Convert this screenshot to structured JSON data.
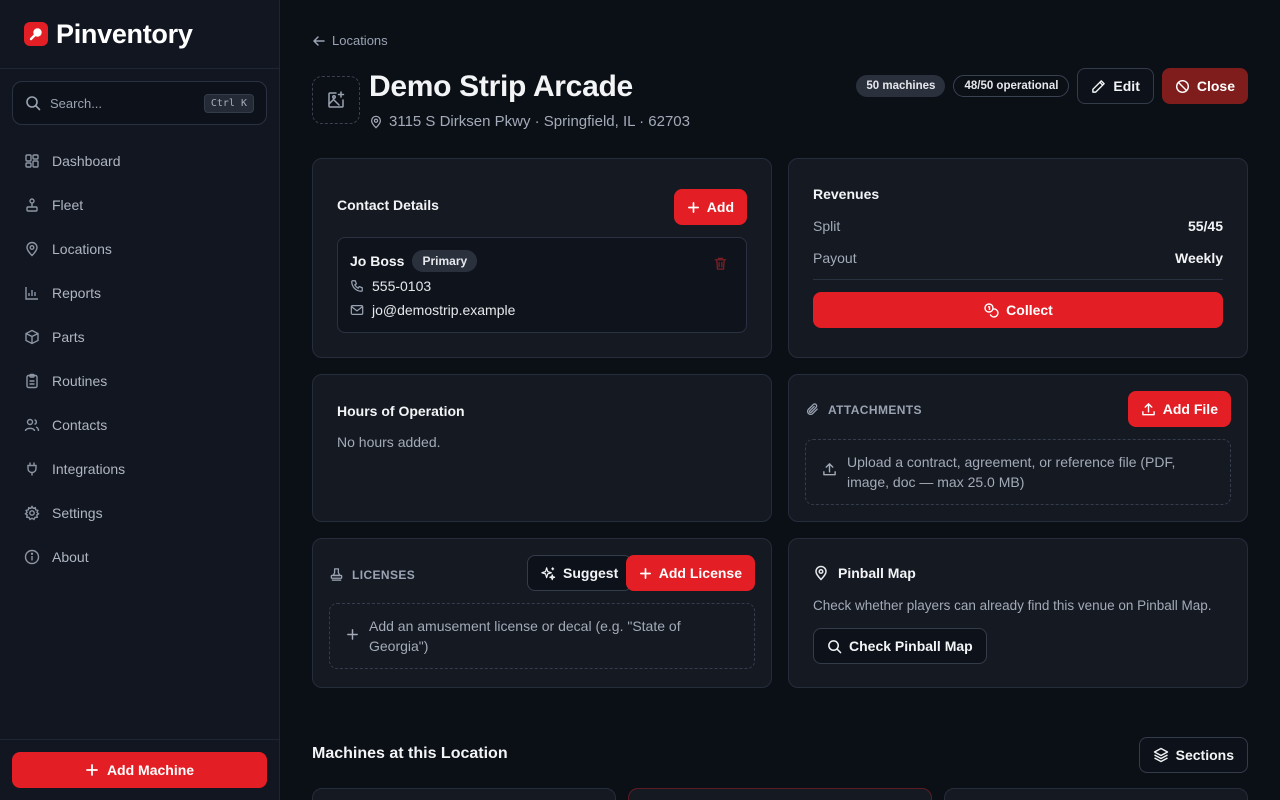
{
  "app": {
    "brand": "Pinventory",
    "search_placeholder": "Search...",
    "search_shortcut": "Ctrl K"
  },
  "sidebar": {
    "items": [
      {
        "label": "Dashboard",
        "icon": "dashboard-icon"
      },
      {
        "label": "Fleet",
        "icon": "fleet-icon"
      },
      {
        "label": "Locations",
        "icon": "map-pin-icon"
      },
      {
        "label": "Reports",
        "icon": "chart-icon"
      },
      {
        "label": "Parts",
        "icon": "box-icon"
      },
      {
        "label": "Routines",
        "icon": "clipboard-icon"
      },
      {
        "label": "Contacts",
        "icon": "users-icon"
      },
      {
        "label": "Integrations",
        "icon": "plug-icon"
      },
      {
        "label": "Settings",
        "icon": "gear-icon"
      },
      {
        "label": "About",
        "icon": "info-icon"
      }
    ],
    "add_machine_label": "Add Machine"
  },
  "header": {
    "breadcrumb": "Locations",
    "title": "Demo Strip Arcade",
    "address": "3115 S Dirksen Pkwy · Springfield, IL · 62703",
    "badge_machines": "50 machines",
    "badge_operational": "48/50 operational",
    "edit_label": "Edit",
    "close_label": "Close"
  },
  "contact_details": {
    "title": "Contact Details",
    "add_label": "Add",
    "contact": {
      "name": "Jo Boss",
      "role_badge": "Primary",
      "phone": "555-0103",
      "email": "jo@demostrip.example"
    }
  },
  "revenues": {
    "title": "Revenues",
    "split_label": "Split",
    "split_value": "55/45",
    "payout_label": "Payout",
    "payout_value": "Weekly",
    "collect_label": "Collect"
  },
  "hours": {
    "title": "Hours of Operation",
    "empty_text": "No hours added."
  },
  "attachments": {
    "title": "ATTACHMENTS",
    "add_file_label": "Add File",
    "upload_hint": "Upload a contract, agreement, or reference file (PDF, image, doc — max 25.0 MB)"
  },
  "licenses": {
    "title": "LICENSES",
    "suggest_label": "Suggest",
    "add_label": "Add License",
    "hint": "Add an amusement license or decal (e.g. \"State of Georgia\")"
  },
  "pinball_map": {
    "title": "Pinball Map",
    "description": "Check whether players can already find this venue on Pinball Map.",
    "check_label": "Check Pinball Map"
  },
  "machines": {
    "title": "Machines at this Location",
    "sections_label": "Sections"
  },
  "colors": {
    "accent": "#e31e24",
    "danger_dark": "#7f1d1d",
    "background": "#0b0f16",
    "card": "#141922"
  }
}
